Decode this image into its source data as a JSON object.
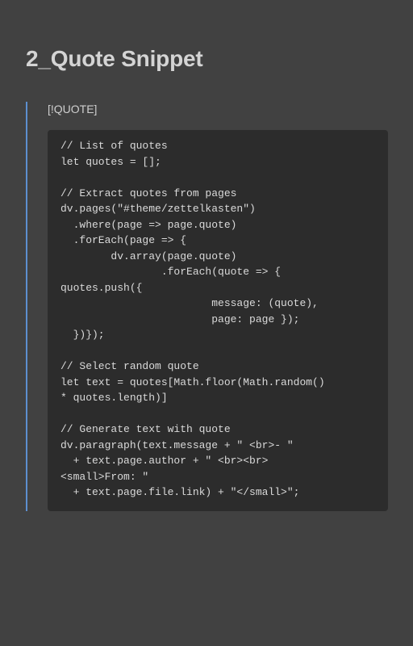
{
  "page": {
    "title": "2_Quote Snippet"
  },
  "callout": {
    "label": "[!QUOTE]",
    "code": "// List of quotes\nlet quotes = [];\n\n// Extract quotes from pages\ndv.pages(\"#theme/zettelkasten\")\n  .where(page => page.quote)\n  .forEach(page => {\n        dv.array(page.quote)\n                .forEach(quote => {\nquotes.push({\n                        message: (quote),\n                        page: page });\n  })});\n\n// Select random quote\nlet text = quotes[Math.floor(Math.random()\n* quotes.length)]\n\n// Generate text with quote\ndv.paragraph(text.message + \" <br>- \"\n  + text.page.author + \" <br><br>\n<small>From: \"\n  + text.page.file.link) + \"</small>\";"
  },
  "colors": {
    "background": "#414141",
    "code_background": "#2c2c2c",
    "callout_border": "#5c8fcf",
    "text": "#d4d4d4"
  }
}
